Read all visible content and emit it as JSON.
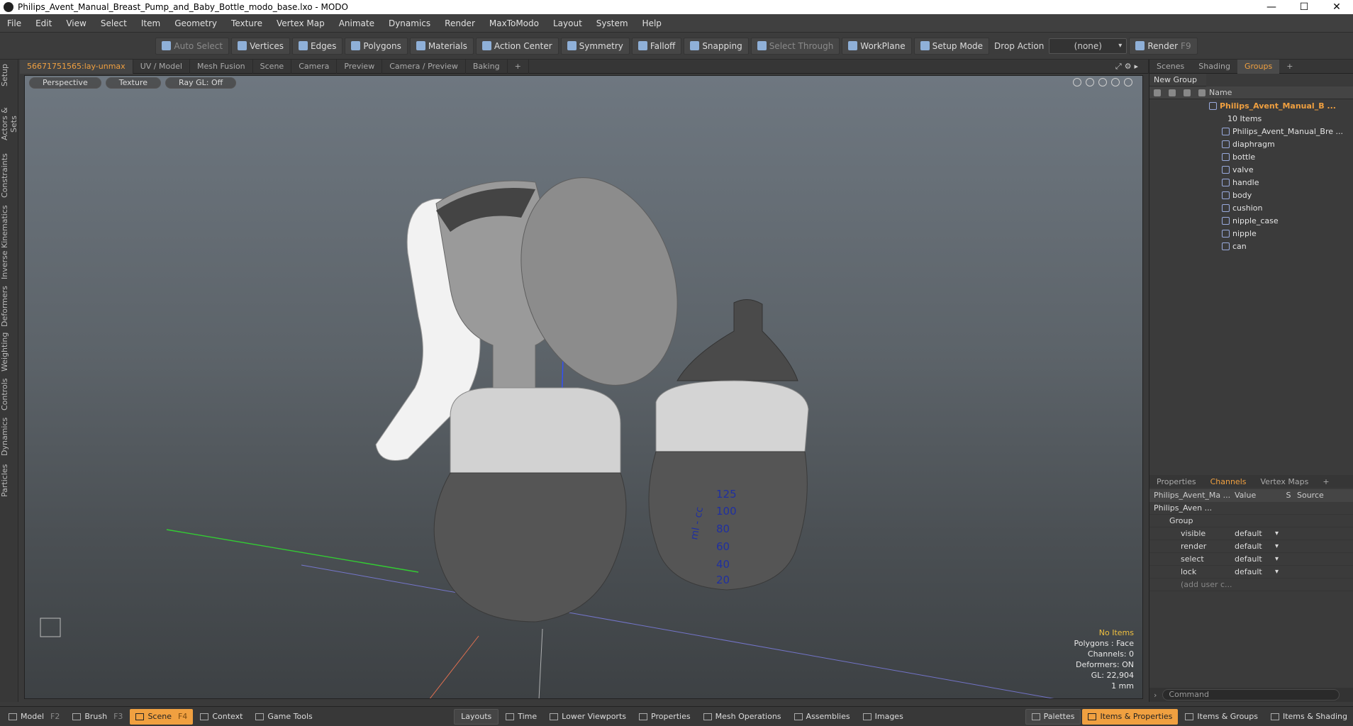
{
  "window": {
    "title": "Philips_Avent_Manual_Breast_Pump_and_Baby_Bottle_modo_base.lxo - MODO",
    "controls": [
      "—",
      "☐",
      "✕"
    ]
  },
  "menu": [
    "File",
    "Edit",
    "View",
    "Select",
    "Item",
    "Geometry",
    "Texture",
    "Vertex Map",
    "Animate",
    "Dynamics",
    "Render",
    "MaxToModo",
    "Layout",
    "System",
    "Help"
  ],
  "toolbar": {
    "auto_select": "Auto Select",
    "vertices": "Vertices",
    "edges": "Edges",
    "polygons": "Polygons",
    "materials": "Materials",
    "action_center": "Action Center",
    "symmetry": "Symmetry",
    "falloff": "Falloff",
    "snapping": "Snapping",
    "select_through": "Select Through",
    "workplane": "WorkPlane",
    "setup_mode": "Setup Mode",
    "drop_action": "Drop Action",
    "drop_value": "(none)",
    "render": "Render",
    "render_key": "F9"
  },
  "left_tabs": [
    "Setup",
    "Actors & Sets",
    "Constraints",
    "Inverse Kinematics",
    "Deformers",
    "Weighting",
    "Controls",
    "Dynamics",
    "Particles"
  ],
  "viewport_tabs": [
    "56671751565:lay-unmax",
    "UV / Model",
    "Mesh Fusion",
    "Scene",
    "Camera",
    "Preview",
    "Camera / Preview",
    "Baking",
    "+"
  ],
  "viewport": {
    "view": "Perspective",
    "shading": "Texture",
    "raygl": "Ray GL: Off",
    "bottle_marks": [
      "125",
      "100",
      "80",
      "60",
      "40",
      "20"
    ],
    "bottle_unit": "ml - cc",
    "stats": {
      "items": "No Items",
      "polygons": "Polygons : Face",
      "channels": "Channels: 0",
      "deformers": "Deformers: ON",
      "gl": "GL: 22,904",
      "scale": "1 mm"
    }
  },
  "right_tabs": [
    "Scenes",
    "Shading",
    "Groups",
    "+"
  ],
  "groups": {
    "new_group": "New Group",
    "name_header": "Name",
    "root": "Philips_Avent_Manual_B ...",
    "count": "10 Items",
    "items": [
      "Philips_Avent_Manual_Bre ...",
      "diaphragm",
      "bottle",
      "valve",
      "handle",
      "body",
      "cushion",
      "nipple_case",
      "nipple",
      "can"
    ]
  },
  "channels": {
    "tabs": [
      "Properties",
      "Channels",
      "Vertex Maps",
      "+"
    ],
    "headers": [
      "Philips_Avent_Ma ...",
      "Value",
      "S",
      "Source"
    ],
    "root": "Philips_Aven ...",
    "group": "Group",
    "rows": [
      {
        "name": "visible",
        "value": "default"
      },
      {
        "name": "render",
        "value": "default"
      },
      {
        "name": "select",
        "value": "default"
      },
      {
        "name": "lock",
        "value": "default"
      }
    ],
    "add": "(add user c...",
    "command_placeholder": "Command"
  },
  "bottom": {
    "model": "Model",
    "model_key": "F2",
    "brush": "Brush",
    "brush_key": "F3",
    "scene": "Scene",
    "scene_key": "F4",
    "context": "Context",
    "game_tools": "Game Tools",
    "layouts": "Layouts",
    "time": "Time",
    "lower_viewports": "Lower Viewports",
    "properties": "Properties",
    "mesh_operations": "Mesh Operations",
    "assemblies": "Assemblies",
    "images": "Images",
    "palettes": "Palettes",
    "items_properties": "Items & Properties",
    "items_groups": "Items & Groups",
    "items_shading": "Items & Shading"
  },
  "colors": {
    "accent": "#f0a040"
  }
}
